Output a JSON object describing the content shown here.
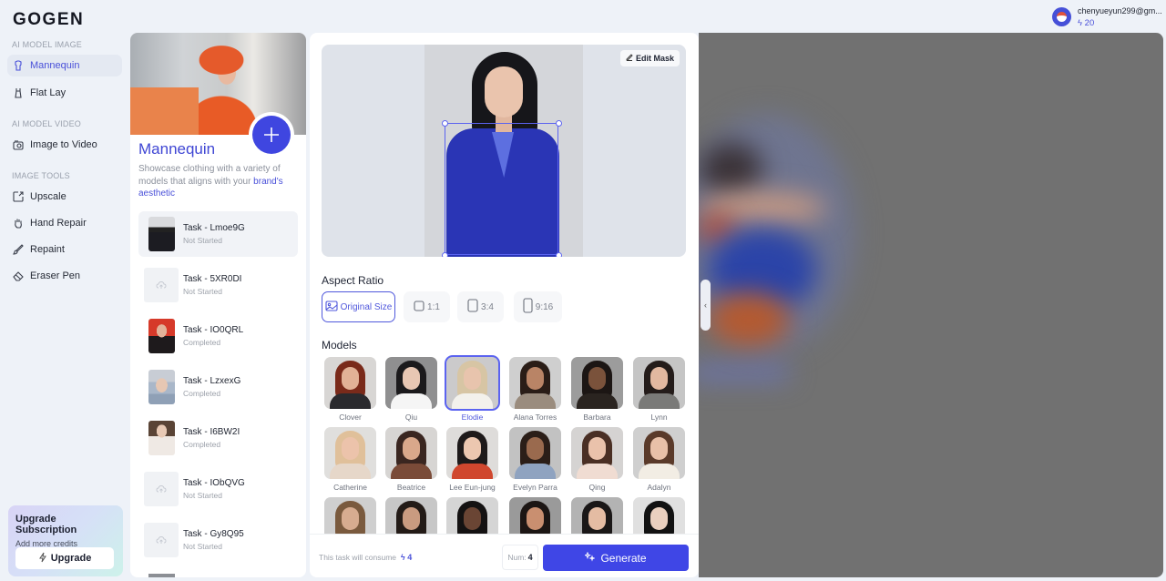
{
  "app": {
    "logo": "GOGEN"
  },
  "user": {
    "email": "chenyueyun299@gm...",
    "credits": "20",
    "avatar_icon": "user-avatar-icon"
  },
  "sidebar": {
    "sections": [
      {
        "title": "AI MODEL IMAGE",
        "items": [
          {
            "label": "Mannequin",
            "icon": "mannequin-icon",
            "active": true
          },
          {
            "label": "Flat Lay",
            "icon": "dress-icon",
            "active": false
          }
        ]
      },
      {
        "title": "AI MODEL VIDEO",
        "items": [
          {
            "label": "Image to Video",
            "icon": "video-icon",
            "active": false
          }
        ]
      },
      {
        "title": "IMAGE TOOLS",
        "items": [
          {
            "label": "Upscale",
            "icon": "upscale-icon",
            "active": false
          },
          {
            "label": "Hand Repair",
            "icon": "hand-icon",
            "active": false
          },
          {
            "label": "Repaint",
            "icon": "brush-icon",
            "active": false
          },
          {
            "label": "Eraser Pen",
            "icon": "eraser-icon",
            "active": false
          }
        ]
      }
    ],
    "upgrade": {
      "title": "Upgrade Subscription",
      "subtitle": "Add more credits",
      "button": "Upgrade"
    }
  },
  "task_panel": {
    "title": "Mannequin",
    "description": "Showcase clothing with a variety of models that aligns with your ",
    "description_highlight": "brand's aesthetic",
    "tasks": [
      {
        "name": "Task - Lmoe9G",
        "status": "Not Started",
        "thumb": "photo-blue-suit",
        "active": true
      },
      {
        "name": "Task - 5XR0DI",
        "status": "Not Started",
        "thumb": "empty",
        "active": false
      },
      {
        "name": "Task - IO0QRL",
        "status": "Completed",
        "thumb": "photo-red",
        "active": false
      },
      {
        "name": "Task - LzxexG",
        "status": "Completed",
        "thumb": "photo-winter",
        "active": false
      },
      {
        "name": "Task - I6BW2I",
        "status": "Completed",
        "thumb": "photo-white",
        "active": false
      },
      {
        "name": "Task - IObQVG",
        "status": "Not Started",
        "thumb": "empty",
        "active": false
      },
      {
        "name": "Task - Gy8Q95",
        "status": "Not Started",
        "thumb": "empty",
        "active": false
      }
    ]
  },
  "editor": {
    "edit_mask_label": "Edit Mask",
    "aspect_ratio_label": "Aspect Ratio",
    "aspect_ratios": [
      {
        "label": "Original Size",
        "active": true
      },
      {
        "label": "1:1",
        "active": false
      },
      {
        "label": "3:4",
        "active": false
      },
      {
        "label": "9:16",
        "active": false
      }
    ],
    "models_label": "Models",
    "models": [
      {
        "name": "Clover",
        "active": false,
        "hair": "#7a2a1a",
        "skin": "#e2b196",
        "top": "#2a2a2e",
        "bg": "#d8d6d4"
      },
      {
        "name": "Qiu",
        "active": false,
        "hair": "#1b1a1c",
        "skin": "#e8c7b3",
        "top": "#f5f5f5",
        "bg": "#8f8f90"
      },
      {
        "name": "Elodie",
        "active": true,
        "hair": "#d7c5a4",
        "skin": "#e8c4ad",
        "top": "#f3f1ec",
        "bg": "#cbcacb"
      },
      {
        "name": "Alana Torres",
        "active": false,
        "hair": "#2a1d17",
        "skin": "#b98466",
        "top": "#9a8c7e",
        "bg": "#cfcfcf"
      },
      {
        "name": "Barbara",
        "active": false,
        "hair": "#1c1614",
        "skin": "#7a523b",
        "top": "#2a2420",
        "bg": "#9c9c9c"
      },
      {
        "name": "Lynn",
        "active": false,
        "hair": "#241c1a",
        "skin": "#e2b8a0",
        "top": "#7a7a78",
        "bg": "#c5c5c5"
      },
      {
        "name": "Catherine",
        "active": false,
        "hair": "#e0c09a",
        "skin": "#ecc3ab",
        "top": "#e6d7c9",
        "bg": "#e0dfdd"
      },
      {
        "name": "Beatrice",
        "active": false,
        "hair": "#3a2620",
        "skin": "#d9a88b",
        "top": "#7a4b38",
        "bg": "#d7d5d3"
      },
      {
        "name": "Lee Eun-jung",
        "active": false,
        "hair": "#1e1a1a",
        "skin": "#ecc7b0",
        "top": "#d0472e",
        "bg": "#dedcda"
      },
      {
        "name": "Evelyn Parra",
        "active": false,
        "hair": "#2b1e18",
        "skin": "#9a6a4e",
        "top": "#8fa3c0",
        "bg": "#c2c2c2"
      },
      {
        "name": "Qing",
        "active": false,
        "hair": "#4a2f24",
        "skin": "#eac2ab",
        "top": "#f0dcd2",
        "bg": "#d5d3d2"
      },
      {
        "name": "Adalyn",
        "active": false,
        "hair": "#5a3a2a",
        "skin": "#e8c0a8",
        "top": "#f2ede4",
        "bg": "#cfcfcf"
      },
      {
        "name": "",
        "active": false,
        "hair": "#7a5a3e",
        "skin": "#d7ac90",
        "top": "#eeeeee",
        "bg": "#cfcfcf"
      },
      {
        "name": "",
        "active": false,
        "hair": "#231b17",
        "skin": "#c99b80",
        "top": "#5e7a98",
        "bg": "#c7c7c7"
      },
      {
        "name": "",
        "active": false,
        "hair": "#141212",
        "skin": "#6a4534",
        "top": "#f4f4f4",
        "bg": "#d5d5d5"
      },
      {
        "name": "",
        "active": false,
        "hair": "#1c1614",
        "skin": "#c98f70",
        "top": "#2a2826",
        "bg": "#9a9a9a"
      },
      {
        "name": "",
        "active": false,
        "hair": "#1a1717",
        "skin": "#e4bca3",
        "top": "#f4f4f4",
        "bg": "#b3b3b3"
      },
      {
        "name": "",
        "active": false,
        "hair": "#121212",
        "skin": "#ead0bf",
        "top": "#f4f4f4",
        "bg": "#e0e0e0"
      }
    ],
    "footer": {
      "consume_label": "This task will consume",
      "consume_value": "4",
      "num_label": "Num:",
      "num_value": "4",
      "generate_label": "Generate"
    }
  },
  "colors": {
    "accent": "#3f46e6",
    "accent_text": "#4950d9"
  }
}
